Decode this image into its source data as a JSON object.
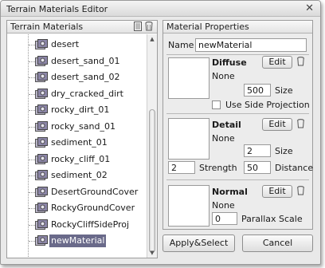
{
  "window": {
    "title": "Terrain Materials Editor",
    "close_glyph": "✕"
  },
  "left_panel": {
    "header": "Terrain Materials",
    "items": [
      {
        "label": "desert",
        "selected": false
      },
      {
        "label": "desert_sand_01",
        "selected": false
      },
      {
        "label": "desert_sand_02",
        "selected": false
      },
      {
        "label": "dry_cracked_dirt",
        "selected": false
      },
      {
        "label": "rocky_dirt_01",
        "selected": false
      },
      {
        "label": "rocky_sand_01",
        "selected": false
      },
      {
        "label": "sediment_01",
        "selected": false
      },
      {
        "label": "rocky_cliff_01",
        "selected": false
      },
      {
        "label": "sediment_02",
        "selected": false
      },
      {
        "label": "DesertGroundCover",
        "selected": false
      },
      {
        "label": "RockyGroundCover",
        "selected": false
      },
      {
        "label": "RockyCliffSideProj",
        "selected": false
      },
      {
        "label": "newMaterial",
        "selected": true
      }
    ]
  },
  "props": {
    "header": "Material Properties",
    "name_label": "Name",
    "name_value": "newMaterial",
    "diffuse": {
      "title": "Diffuse",
      "edit": "Edit",
      "texture": "None",
      "size_value": "500",
      "size_label": "Size",
      "side_projection_label": "Use Side Projection"
    },
    "detail": {
      "title": "Detail",
      "edit": "Edit",
      "texture": "None",
      "size_value": "2",
      "size_label": "Size",
      "strength_value": "2",
      "strength_label": "Strength",
      "distance_value": "50",
      "distance_label": "Distance"
    },
    "normal": {
      "title": "Normal",
      "edit": "Edit",
      "texture": "None",
      "parallax_value": "0",
      "parallax_label": "Parallax Scale"
    }
  },
  "buttons": {
    "apply": "Apply&Select",
    "cancel": "Cancel"
  },
  "colors": {
    "selection": "#6a6a8a",
    "window_bg": "#e9e9e9"
  }
}
